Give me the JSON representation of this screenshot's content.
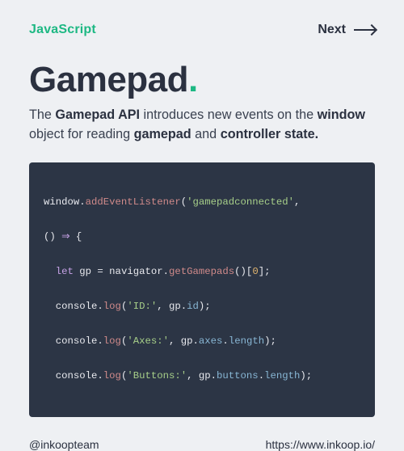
{
  "header": {
    "brand": "JavaScript",
    "next_label": "Next"
  },
  "title": {
    "text": "Gamepad",
    "punct": "."
  },
  "desc": {
    "t1": "The ",
    "b1": "Gamepad API",
    "t2": " introduces new events on the ",
    "b2": "window",
    "t3": " object for reading ",
    "b3": "gamepad",
    "t4": " and ",
    "b4": "controller state."
  },
  "code": {
    "l1": {
      "a": "window.",
      "b": "addEventListener",
      "c": "(",
      "d": "'gamepadconnected'",
      "e": ","
    },
    "l2": {
      "a": "() ",
      "b": "⇒",
      "c": " {"
    },
    "l3": {
      "a": "  ",
      "b": "let",
      "c": " gp = navigator.",
      "d": "getGamepads",
      "e": "()[",
      "f": "0",
      "g": "];"
    },
    "l4": {
      "a": "  console.",
      "b": "log",
      "c": "(",
      "d": "'ID:'",
      "e": ", gp.",
      "f": "id",
      "g": ");"
    },
    "l5": {
      "a": "  console.",
      "b": "log",
      "c": "(",
      "d": "'Axes:'",
      "e": ", gp.",
      "f": "axes",
      "g": ".",
      "h": "length",
      "i": ");"
    },
    "l6": {
      "a": "  console.",
      "b": "log",
      "c": "(",
      "d": "'Buttons:'",
      "e": ", gp.",
      "f": "buttons",
      "g": ".",
      "h": "length",
      "i": ");"
    }
  },
  "footer": {
    "handle": "@inkoopteam",
    "url": "https://www.inkoop.io/"
  }
}
